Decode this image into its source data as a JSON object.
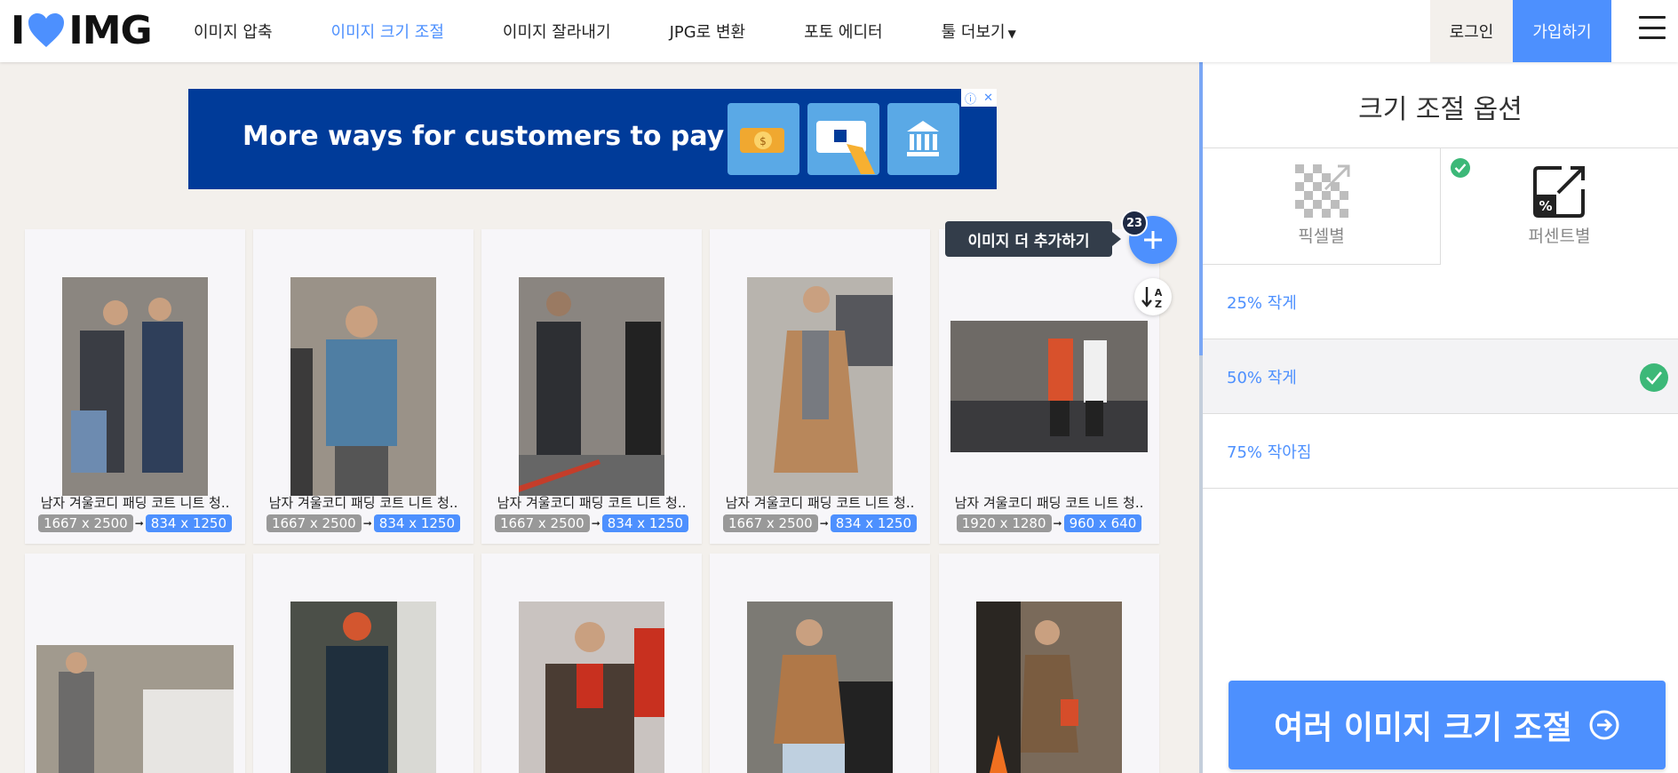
{
  "brand": {
    "logo_left": "I",
    "logo_right": "IMG",
    "heart_color": "#4d90fe"
  },
  "nav": {
    "items": [
      {
        "label": "이미지 압축"
      },
      {
        "label": "이미지 크기 조절",
        "active": true
      },
      {
        "label": "이미지 잘라내기"
      },
      {
        "label": "JPG로 변환"
      },
      {
        "label": "포토 에디터"
      },
      {
        "label": "툴 더보기"
      }
    ],
    "login_label": "로그인",
    "signup_label": "가입하기"
  },
  "ad": {
    "text": "More ways for customers to pay",
    "background": "#003b99"
  },
  "images": [
    {
      "name": "남자 겨울코디 패딩 코트 니트 청..",
      "orig": "1667 x 2500",
      "new": "834 x 1250",
      "palette": [
        "#8b8680",
        "#3a3d44",
        "#6d8bb0"
      ]
    },
    {
      "name": "남자 겨울코디 패딩 코트 니트 청..",
      "orig": "1667 x 2500",
      "new": "834 x 1250",
      "palette": [
        "#9a9288",
        "#4f7ea3",
        "#3b3a3a"
      ]
    },
    {
      "name": "남자 겨울코디 패딩 코트 니트 청..",
      "orig": "1667 x 2500",
      "new": "834 x 1250",
      "palette": [
        "#8a8580",
        "#2d2f33",
        "#c43d2a"
      ]
    },
    {
      "name": "남자 겨울코디 패딩 코트 니트 청..",
      "orig": "1667 x 2500",
      "new": "834 x 1250",
      "palette": [
        "#b8b4ae",
        "#b8875b",
        "#56575c"
      ]
    },
    {
      "name": "남자 겨울코디 패딩 코트 니트 청..",
      "orig": "1920 x 1280",
      "new": "960 x 640",
      "palette": [
        "#6e6a66",
        "#d8512c",
        "#3a3a3d"
      ]
    },
    {
      "palette": [
        "#a19a8e",
        "#6c6b6a",
        "#e7e5e2"
      ]
    },
    {
      "palette": [
        "#4b4f48",
        "#1f2f3d",
        "#d3562f"
      ]
    },
    {
      "palette": [
        "#c9c3c0",
        "#4a3c33",
        "#c8301f"
      ]
    },
    {
      "palette": [
        "#7c7a74",
        "#b07848",
        "#bfd0e0"
      ]
    },
    {
      "palette": [
        "#7a6a5a",
        "#7a5c40",
        "#d64d2a"
      ]
    }
  ],
  "floating": {
    "add_label": "이미지 더 추가하기",
    "count": "23",
    "sort_label": "AZ"
  },
  "panel": {
    "title": "크기 조절 옵션",
    "mode_pixel": "픽셀별",
    "mode_percent": "퍼센트별",
    "selected_mode": "percent",
    "options": [
      {
        "label": "25% 작게",
        "selected": false
      },
      {
        "label": "50% 작게",
        "selected": true
      },
      {
        "label": "75% 작아짐",
        "selected": false
      }
    ],
    "cta_label": "여러 이미지 크기 조절"
  }
}
